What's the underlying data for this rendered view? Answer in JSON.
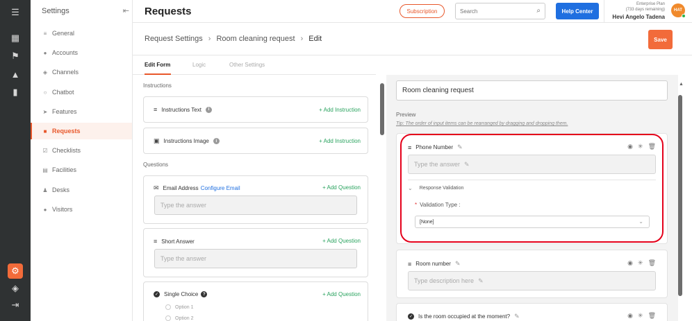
{
  "rail": {
    "icons": [
      "menu-toggle-icon",
      "dashboard-icon",
      "flag-icon",
      "chart-icon",
      "stats-icon",
      "settings-gear-icon",
      "box-icon",
      "logout-icon"
    ]
  },
  "sidebar": {
    "heading": "Settings",
    "items": [
      {
        "label": "General",
        "icon": "sliders-icon"
      },
      {
        "label": "Accounts",
        "icon": "users-icon"
      },
      {
        "label": "Channels",
        "icon": "cube-icon"
      },
      {
        "label": "Chatbot",
        "icon": "chat-icon"
      },
      {
        "label": "Features",
        "icon": "rocket-icon"
      },
      {
        "label": "Requests",
        "icon": "request-icon"
      },
      {
        "label": "Checklists",
        "icon": "checklist-icon"
      },
      {
        "label": "Facilities",
        "icon": "calendar-icon"
      },
      {
        "label": "Desks",
        "icon": "person-desk-icon"
      },
      {
        "label": "Visitors",
        "icon": "visitors-icon"
      }
    ],
    "active": "Requests"
  },
  "topbar": {
    "title": "Requests",
    "subscription_label": "Subscription",
    "search_placeholder": "Search",
    "help_label": "Help Center",
    "plan_name": "Enterprise Plan",
    "plan_remaining": "(733 days remaining)",
    "user_name": "Hevi Angelo Tadena",
    "avatar_initials": "HAT"
  },
  "breadcrumb": {
    "items": [
      "Request Settings",
      "Room cleaning request",
      "Edit"
    ],
    "save_label": "Save"
  },
  "tabs": [
    "Edit Form",
    "Logic",
    "Other Settings"
  ],
  "form": {
    "instructions_label": "Instructions",
    "questions_label": "Questions",
    "instruction_cards": [
      {
        "label": "Instructions Text",
        "action": "+ Add Instruction"
      },
      {
        "label": "Instructions Image",
        "action": "+ Add Instruction"
      }
    ],
    "question_cards": [
      {
        "label": "Email Address",
        "link": "Configure Email",
        "action": "+ Add Question",
        "placeholder": "Type the answer"
      },
      {
        "label": "Short Answer",
        "action": "+ Add Question",
        "placeholder": "Type the answer"
      },
      {
        "label": "Single Choice",
        "action": "+ Add Question",
        "options": [
          "Option 1",
          "Option 2"
        ]
      }
    ]
  },
  "preview": {
    "title_value": "Room cleaning request",
    "label": "Preview",
    "tip": "Tip: The order of input items can be rearranged by dragging and dropping them.",
    "cards": [
      {
        "title": "Phone Number",
        "placeholder": "Type the answer",
        "validation_heading": "Response Validation",
        "validation_type_label": "Validation Type :",
        "validation_type_value": "[None]"
      },
      {
        "title": "Room number",
        "placeholder": "Type description here"
      },
      {
        "title": "Is the room occupied at the moment?"
      }
    ]
  }
}
